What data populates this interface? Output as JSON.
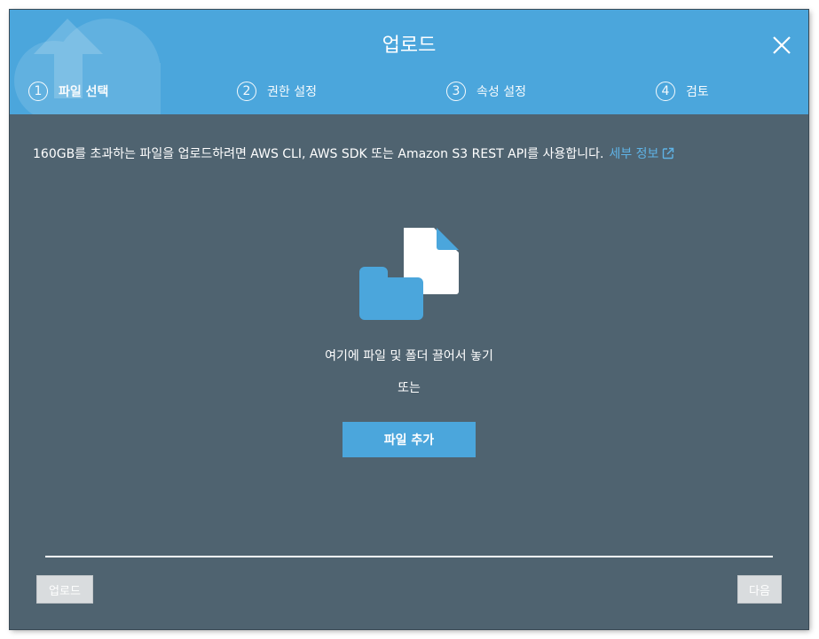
{
  "dialog": {
    "title": "업로드",
    "close_icon": "close-icon"
  },
  "steps": [
    {
      "number": "1",
      "label": "파일 선택",
      "active": true
    },
    {
      "number": "2",
      "label": "권한 설정",
      "active": false
    },
    {
      "number": "3",
      "label": "속성 설정",
      "active": false
    },
    {
      "number": "4",
      "label": "검토",
      "active": false
    }
  ],
  "notice": {
    "text": "160GB를 초과하는 파일을 업로드하려면 AWS CLI, AWS SDK 또는 Amazon S3 REST API를 사용합니다.",
    "link_label": "세부 정보",
    "link_icon": "external-link-icon"
  },
  "drop_zone": {
    "icon": "file-folder-icon",
    "instruction": "여기에 파일 및 폴더 끌어서 놓기",
    "or_text": "또는",
    "add_files_label": "파일 추가"
  },
  "footer": {
    "upload_label": "업로드",
    "next_label": "다음"
  },
  "colors": {
    "header": "#4ba6dc",
    "body": "#4f6370",
    "link": "#5fb3e6",
    "button": "#4ba6dc",
    "disabled_button": "#d9dcde"
  }
}
